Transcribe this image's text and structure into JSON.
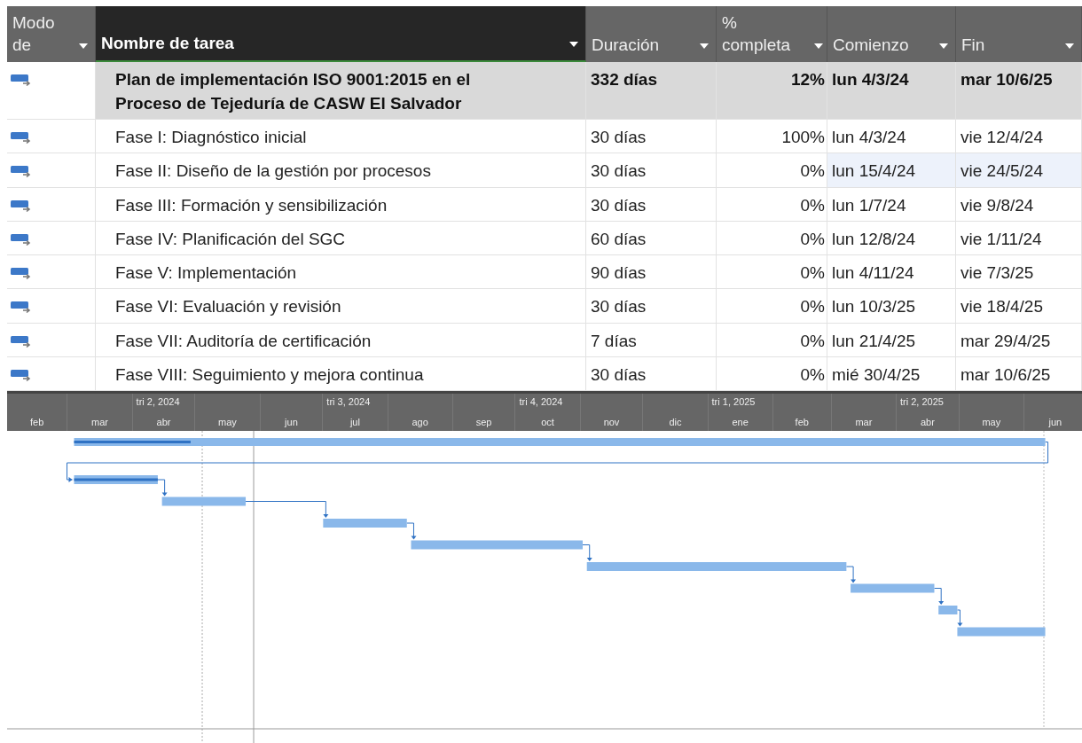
{
  "columns": [
    {
      "label": "Modo de",
      "kind": "mode"
    },
    {
      "label": "Nombre de tarea",
      "kind": "name"
    },
    {
      "label": "Duración",
      "kind": "duration"
    },
    {
      "label": "% completa",
      "kind": "complete"
    },
    {
      "label": "Comienzo",
      "kind": "start"
    },
    {
      "label": "Fin",
      "kind": "finish"
    }
  ],
  "rows": [
    {
      "name": "Plan de implementación ISO 9001:2015 en el Proceso de Tejeduría de CASW El Salvador",
      "duration": "332 días",
      "complete": "12%",
      "start": "lun 4/3/24",
      "finish": "mar 10/6/25",
      "summary": true,
      "highlighted": false
    },
    {
      "name": "Fase I: Diagnóstico inicial",
      "duration": "30 días",
      "complete": "100%",
      "start": "lun 4/3/24",
      "finish": "vie 12/4/24",
      "summary": false,
      "highlighted": false
    },
    {
      "name": "Fase II: Diseño de la gestión por procesos",
      "duration": "30 días",
      "complete": "0%",
      "start": "lun 15/4/24",
      "finish": "vie 24/5/24",
      "summary": false,
      "highlighted": true
    },
    {
      "name": "Fase III: Formación y sensibilización",
      "duration": "30 días",
      "complete": "0%",
      "start": "lun 1/7/24",
      "finish": "vie 9/8/24",
      "summary": false,
      "highlighted": false
    },
    {
      "name": "Fase IV: Planificación del SGC",
      "duration": "60 días",
      "complete": "0%",
      "start": "lun 12/8/24",
      "finish": "vie 1/11/24",
      "summary": false,
      "highlighted": false
    },
    {
      "name": "Fase V: Implementación",
      "duration": "90 días",
      "complete": "0%",
      "start": "lun 4/11/24",
      "finish": "vie 7/3/25",
      "summary": false,
      "highlighted": false
    },
    {
      "name": "Fase VI: Evaluación y revisión",
      "duration": "30 días",
      "complete": "0%",
      "start": "lun 10/3/25",
      "finish": "vie 18/4/25",
      "summary": false,
      "highlighted": false
    },
    {
      "name": "Fase VII: Auditoría de certificación",
      "duration": "7 días",
      "complete": "0%",
      "start": "lun 21/4/25",
      "finish": "mar 29/4/25",
      "summary": false,
      "highlighted": false
    },
    {
      "name": "Fase VIII: Seguimiento y mejora continua",
      "duration": "30 días",
      "complete": "0%",
      "start": "mié 30/4/25",
      "finish": "mar 10/6/25",
      "summary": false,
      "highlighted": false
    }
  ],
  "timescale": {
    "months": [
      {
        "label": "feb"
      },
      {
        "label": "mar"
      },
      {
        "label": "abr",
        "quarter": "tri 2, 2024"
      },
      {
        "label": "may"
      },
      {
        "label": "jun"
      },
      {
        "label": "jul",
        "quarter": "tri 3, 2024"
      },
      {
        "label": "ago"
      },
      {
        "label": "sep"
      },
      {
        "label": "oct",
        "quarter": "tri 4, 2024"
      },
      {
        "label": "nov"
      },
      {
        "label": "dic"
      },
      {
        "label": "ene",
        "quarter": "tri 1, 2025"
      },
      {
        "label": "feb"
      },
      {
        "label": "mar"
      },
      {
        "label": "abr",
        "quarter": "tri 2, 2025"
      },
      {
        "label": "may"
      },
      {
        "label": "jun"
      }
    ]
  }
}
